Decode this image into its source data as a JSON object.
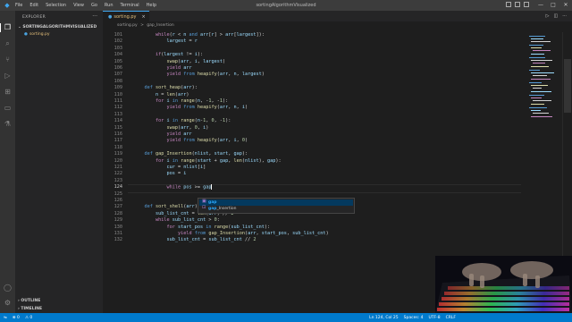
{
  "window": {
    "title": "sortingAlgorithmVisualized",
    "menu": [
      "File",
      "Edit",
      "Selection",
      "View",
      "Go",
      "Run",
      "Terminal",
      "Help"
    ]
  },
  "sidebar": {
    "header": "EXPLORER",
    "folder": "SORTINGALGORITHMVISUALIZED",
    "file": "sorting.py",
    "outline": "OUTLINE",
    "timeline": "TIMELINE"
  },
  "tab": {
    "label": "sorting.py",
    "close": "×"
  },
  "breadcrumb": {
    "file": "sorting.py",
    "sep": ">",
    "symbol": "gap_Insertion"
  },
  "code_lines": [
    {
      "n": "101",
      "t": "        while(r < n and arr[r] > arr[largest]):"
    },
    {
      "n": "102",
      "t": "            largest = r"
    },
    {
      "n": "103",
      "t": ""
    },
    {
      "n": "104",
      "t": "        if(largest != i):"
    },
    {
      "n": "105",
      "t": "            swap(arr, i, largest)"
    },
    {
      "n": "106",
      "t": "            yield arr"
    },
    {
      "n": "107",
      "t": "            yield from heapify(arr, n, largest)"
    },
    {
      "n": "108",
      "t": ""
    },
    {
      "n": "109",
      "t": "    def sort_heap(arr):"
    },
    {
      "n": "110",
      "t": "        n = len(arr)"
    },
    {
      "n": "111",
      "t": "        for i in range(n, -1, -1):"
    },
    {
      "n": "112",
      "t": "            yield from heapify(arr, n, i)"
    },
    {
      "n": "113",
      "t": ""
    },
    {
      "n": "114",
      "t": "        for i in range(n-1, 0, -1):"
    },
    {
      "n": "115",
      "t": "            swap(arr, 0, i)"
    },
    {
      "n": "116",
      "t": "            yield arr"
    },
    {
      "n": "117",
      "t": "            yield from heapify(arr, i, 0)"
    },
    {
      "n": "118",
      "t": ""
    },
    {
      "n": "119",
      "t": "    def gap_Insertion(nlist, start, gap):"
    },
    {
      "n": "120",
      "t": "        for i in range(start + gap, len(nlist), gap):"
    },
    {
      "n": "121",
      "t": "            cur = nlist[i]"
    },
    {
      "n": "122",
      "t": "            pos = i"
    },
    {
      "n": "123",
      "t": ""
    },
    {
      "n": "124",
      "t": "            while pos >= gap"
    },
    {
      "n": "125",
      "t": ""
    },
    {
      "n": "126",
      "t": ""
    },
    {
      "n": "127",
      "t": "    def sort_shell(arr):"
    },
    {
      "n": "128",
      "t": "        sub_list_cnt = len(arr) // 2"
    },
    {
      "n": "129",
      "t": "        while sub_list_cnt > 0:"
    },
    {
      "n": "130",
      "t": "            for start_pos in range(sub_list_cnt):"
    },
    {
      "n": "131",
      "t": "                yield from gap_Insertion(arr, start_pos, sub_list_cnt)"
    },
    {
      "n": "132",
      "t": "            sub_list_cnt = sub_list_cnt // 2"
    }
  ],
  "suggestions": [
    {
      "match": "gap",
      "rest": ""
    },
    {
      "match": "gap",
      "rest": "_Insertion"
    }
  ],
  "status": {
    "errors": "⊗ 0",
    "warnings": "⚠ 0",
    "position": "Ln 124, Col 25",
    "spaces": "Spaces: 4",
    "encoding": "UTF-8",
    "eol": "CRLF"
  },
  "colors": {
    "accent": "#007acc",
    "keyword": "#569cd6",
    "control": "#c586c0",
    "function": "#dcdcaa",
    "number": "#b5cea8"
  }
}
